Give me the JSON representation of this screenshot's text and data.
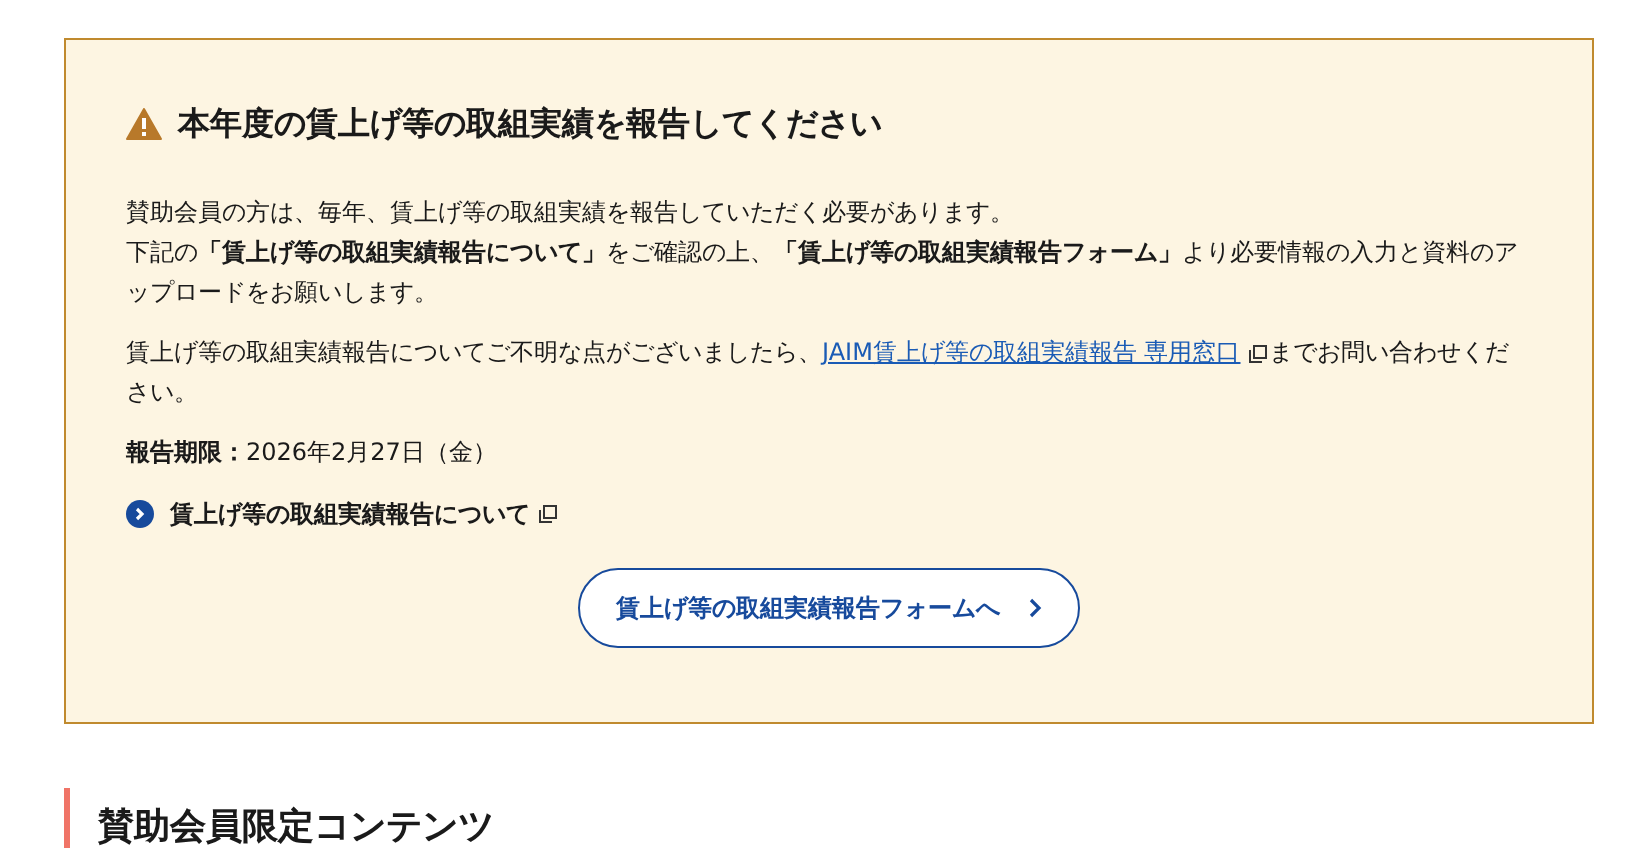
{
  "notice": {
    "title": "本年度の賃上げ等の取組実績を報告してください",
    "intro_lines": [
      "賛助会員の方は、毎年、賃上げ等の取組実績を報告していただく必要があります。",
      "下記の**「賃上げ等の取組実績報告について」**をご確認の上、**「賃上げ等の取組実績報告フォーム」**より必要情報の入力と資料のアップロードをお願いします。"
    ],
    "inquiry": {
      "before": "賃上げ等の取組実績報告についてご不明な点がございましたら、",
      "link": "JAIM賃上げ等の取組実績報告 専用窓口",
      "after": "までお問い合わせください。"
    },
    "deadline": "**報告期限：**2026年2月27日（金）",
    "about_link": "賃上げ等の取組実績報告について",
    "form_button": "賃上げ等の取組実績報告フォームへ"
  },
  "section_heading": "賛助会員限定コンテンツ"
}
